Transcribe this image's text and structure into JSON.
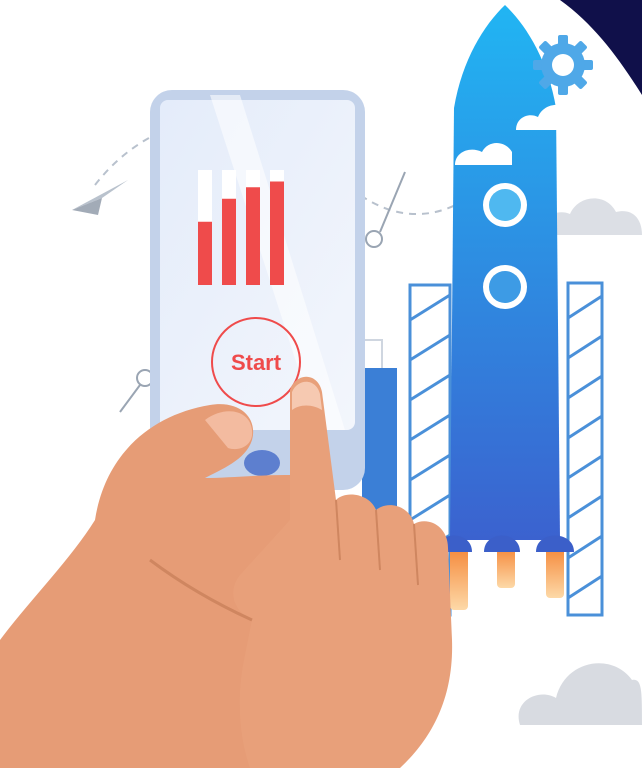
{
  "phone": {
    "start_label": "Start",
    "bar_levels": [
      0.55,
      0.75,
      0.85,
      0.9
    ]
  },
  "icons": [
    "gear-icon",
    "paper-plane-icon",
    "rocket-icon",
    "cloud-icon",
    "smartphone-icon",
    "hand-icon",
    "bar-chart-icon"
  ],
  "colors": {
    "accent_red": "#ef4b4b",
    "rocket_blue_top": "#21b5f3",
    "rocket_blue_bottom": "#3b6fd8",
    "dark_navy_corner": "#10104a",
    "skin": "#e8a07a",
    "cloud_gray": "#d9dde3"
  }
}
